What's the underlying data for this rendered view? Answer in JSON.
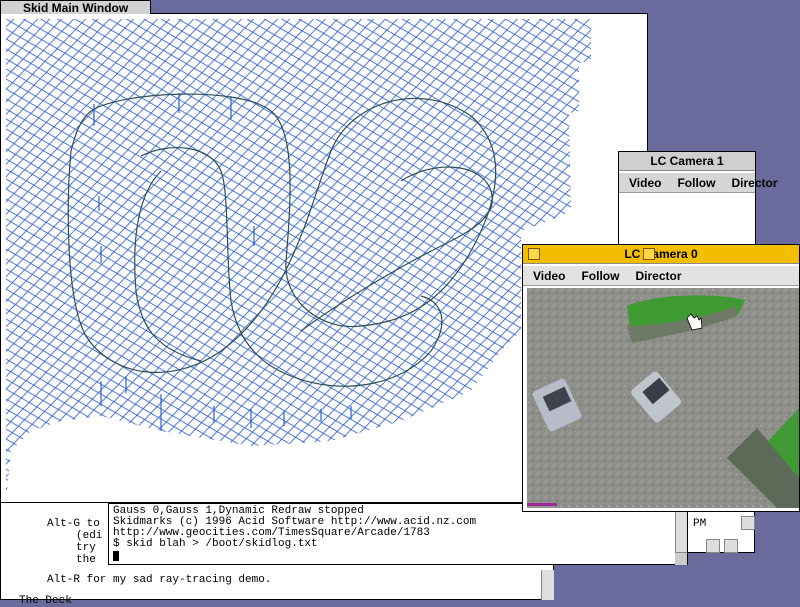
{
  "main_window": {
    "title": "Skid Main Window"
  },
  "background_terminal": {
    "lines": [
      "Alt-G to",
      "(edi",
      "try",
      "the",
      "Alt-R for my sad ray-tracing demo.",
      "The Deck"
    ],
    "right_label": "PM"
  },
  "terminal": {
    "lines": [
      "Gauss 0,Gauss 1,Dynamic Redraw stopped",
      "Skidmarks (c) 1996 Acid Software http://www.acid.nz.com",
      "http://www.geocities.com/TimesSquare/Arcade/1783",
      "$ skid blah > /boot/skidlog.txt"
    ]
  },
  "camera1": {
    "title": "LC Camera 1",
    "menu": [
      "Video",
      "Follow",
      "Director"
    ]
  },
  "camera0": {
    "title": "LC Camera 0",
    "menu": [
      "Video",
      "Follow",
      "Director"
    ]
  },
  "colors": {
    "desktop": "#6a6a9c",
    "mesh": "#2c5fd0",
    "active_title": "#f3be00",
    "track": "#2d4f4f"
  }
}
